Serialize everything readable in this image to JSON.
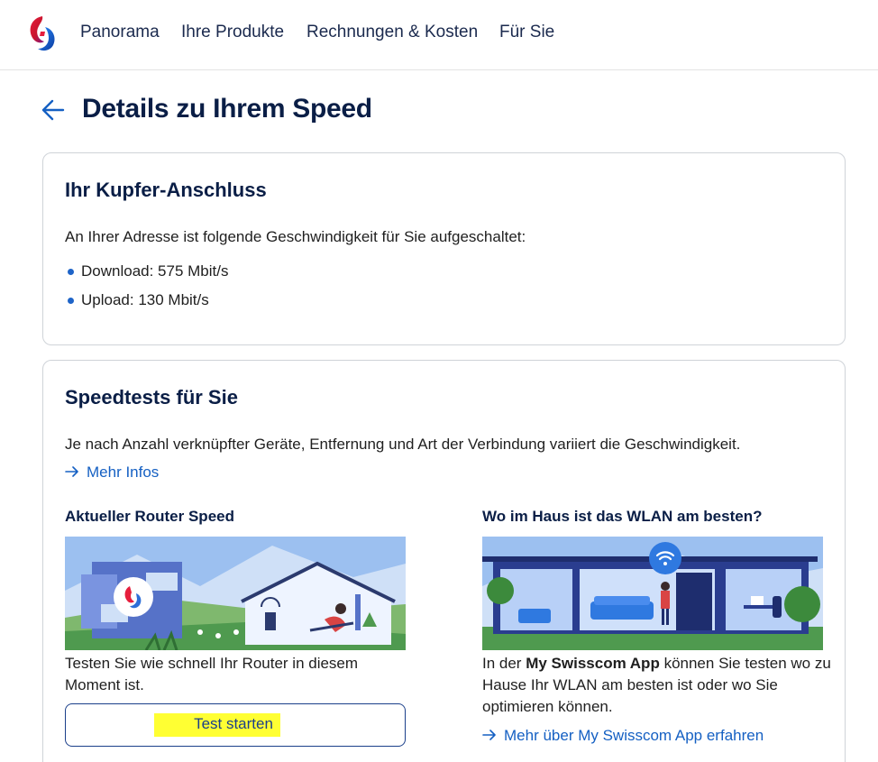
{
  "nav": {
    "items": [
      "Panorama",
      "Ihre Produkte",
      "Rechnungen & Kosten",
      "Für Sie"
    ]
  },
  "header": {
    "title": "Details zu Ihrem Speed"
  },
  "connection_card": {
    "title": "Ihr Kupfer-Anschluss",
    "intro": "An Ihrer Adresse ist folgende Geschwindigkeit für Sie aufgeschaltet:",
    "download": "Download: 575 Mbit/s",
    "upload": "Upload: 130 Mbit/s"
  },
  "speedtest_card": {
    "title": "Speedtests für Sie",
    "intro": "Je nach Anzahl verknüpfter Geräte, Entfernung und Art der Verbindung variiert die Geschwindigkeit.",
    "more_info": "Mehr Infos",
    "router": {
      "title": "Aktueller Router Speed",
      "text_line1": "Testen Sie wie schnell Ihr Router in diesem",
      "text_line2": "Moment ist.",
      "button": "Test starten"
    },
    "wlan": {
      "title": "Wo im Haus ist das WLAN am besten?",
      "text_prefix": "In der ",
      "text_bold": "My Swisscom App",
      "text_suffix": " können Sie testen wo zu",
      "text_line2": "Hause Ihr WLAN am besten ist oder wo Sie",
      "text_line3": "optimieren können.",
      "link": "Mehr über My Swisscom App erfahren"
    }
  },
  "colors": {
    "brand_navy": "#0a1e46",
    "link_blue": "#1560c3",
    "highlight_yellow": "#ffff33",
    "card_border": "#cfd3d8"
  },
  "icons": [
    "swisscom-logo",
    "back-arrow-icon",
    "arrow-right-icon",
    "wifi-icon"
  ]
}
